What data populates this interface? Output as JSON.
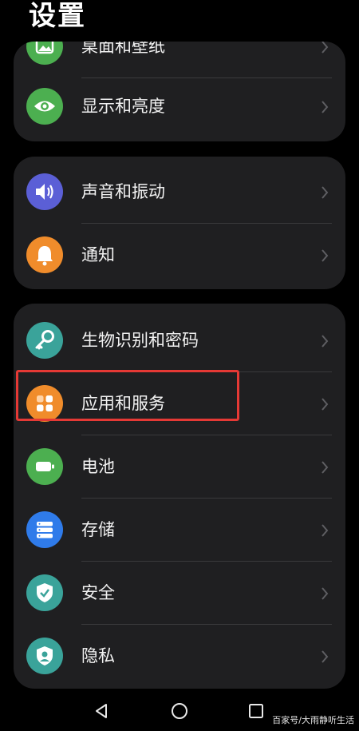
{
  "page": {
    "title": "设置"
  },
  "groups": [
    {
      "items": [
        {
          "label": "桌面和壁纸",
          "icon": "wallpaper-icon",
          "color": "#4caf50"
        },
        {
          "label": "显示和亮度",
          "icon": "eye-icon",
          "color": "#4caf50"
        }
      ]
    },
    {
      "items": [
        {
          "label": "声音和振动",
          "icon": "speaker-icon",
          "color": "#5b5fd6"
        },
        {
          "label": "通知",
          "icon": "bell-icon",
          "color": "#f08c2b"
        }
      ]
    },
    {
      "items": [
        {
          "label": "生物识别和密码",
          "icon": "key-icon",
          "color": "#3aa39a"
        },
        {
          "label": "应用和服务",
          "icon": "apps-icon",
          "color": "#f08c2b"
        },
        {
          "label": "电池",
          "icon": "battery-icon",
          "color": "#4caf50"
        },
        {
          "label": "存储",
          "icon": "storage-icon",
          "color": "#2f7bea"
        },
        {
          "label": "安全",
          "icon": "shield-check-icon",
          "color": "#3aa39a"
        },
        {
          "label": "隐私",
          "icon": "privacy-shield-icon",
          "color": "#3aa39a"
        }
      ]
    }
  ],
  "highlight": {
    "color": "#e53935",
    "target": "应用和服务"
  },
  "navbar": {
    "icons": [
      "back-icon",
      "home-icon",
      "recents-icon"
    ]
  },
  "watermark": "百家号/大雨静听生活"
}
